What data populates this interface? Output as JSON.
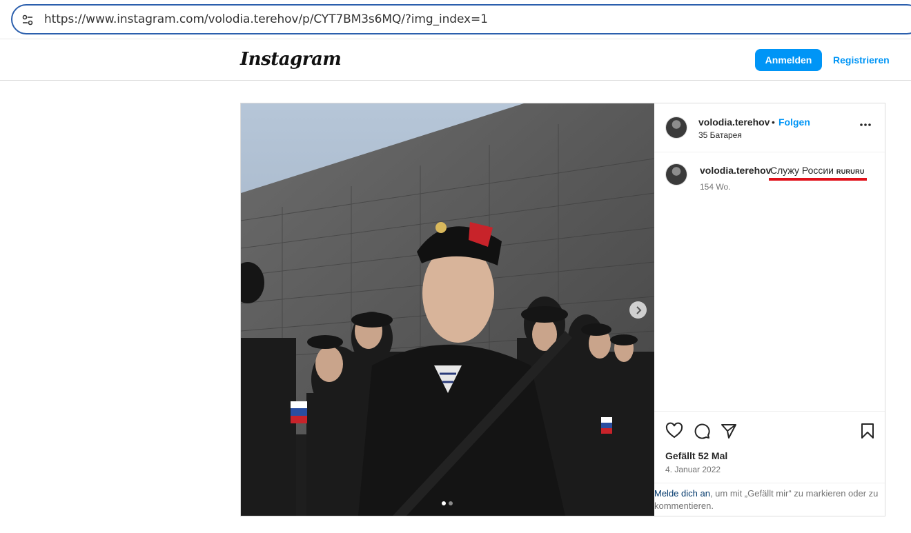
{
  "browser": {
    "url": "https://www.instagram.com/volodia.terehov/p/CYT7BM3s6MQ/?img_index=1"
  },
  "header": {
    "logo_text": "Instagram",
    "login_label": "Anmelden",
    "register_label": "Registrieren"
  },
  "post": {
    "username": "volodia.terehov",
    "separator": "•",
    "follow_label": "Folgen",
    "location": "35 Батарея",
    "caption_username": "volodia.terehov",
    "caption_text": "Служу России ",
    "caption_flags": "RURURU",
    "caption_time": "154 Wo.",
    "likes": "Gefällt 52 Mal",
    "date": "4. Januar 2022",
    "login_link": "Melde dich an",
    "login_rest": ", um mit „Gefällt mir“ zu markieren oder zu kommentieren."
  },
  "colors": {
    "accent": "#0095f6",
    "annotation_underline": "#e0101a",
    "url_border": "#2b5fad"
  },
  "icons": [
    "site-settings-icon",
    "next-arrow-icon",
    "more-options-icon",
    "heart-icon",
    "comment-icon",
    "share-icon",
    "bookmark-icon"
  ]
}
